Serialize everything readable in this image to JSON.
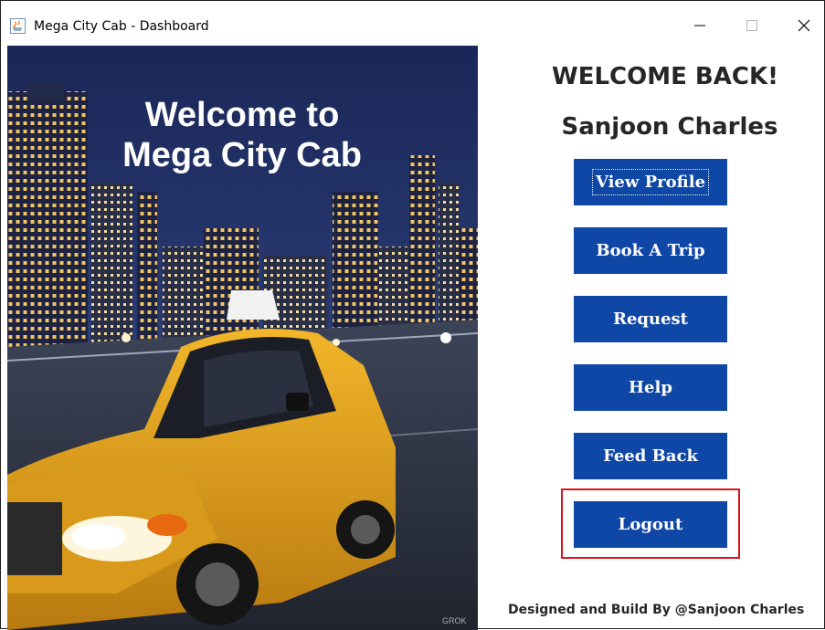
{
  "window": {
    "title": "Mega City Cab - Dashboard",
    "controls": {
      "minimize": "—",
      "maximize": "☐",
      "close": "✕"
    }
  },
  "hero": {
    "line1": "Welcome to",
    "line2": "Mega City Cab",
    "watermark": "GROK"
  },
  "main": {
    "welcome": "WELCOME BACK!",
    "username": "Sanjoon Charles",
    "buttons": [
      {
        "label": "View Profile"
      },
      {
        "label": "Book A Trip"
      },
      {
        "label": "Request"
      },
      {
        "label": "Help"
      },
      {
        "label": "Feed Back"
      },
      {
        "label": "Logout"
      }
    ]
  },
  "footer": {
    "credit": "Designed and Build By @Sanjoon Charles"
  },
  "colors": {
    "button_bg": "#0f47a6",
    "button_text": "#ffffff",
    "highlight": "#e0101a",
    "taxi": "#e8a51a",
    "sky": "#1b2a57"
  }
}
